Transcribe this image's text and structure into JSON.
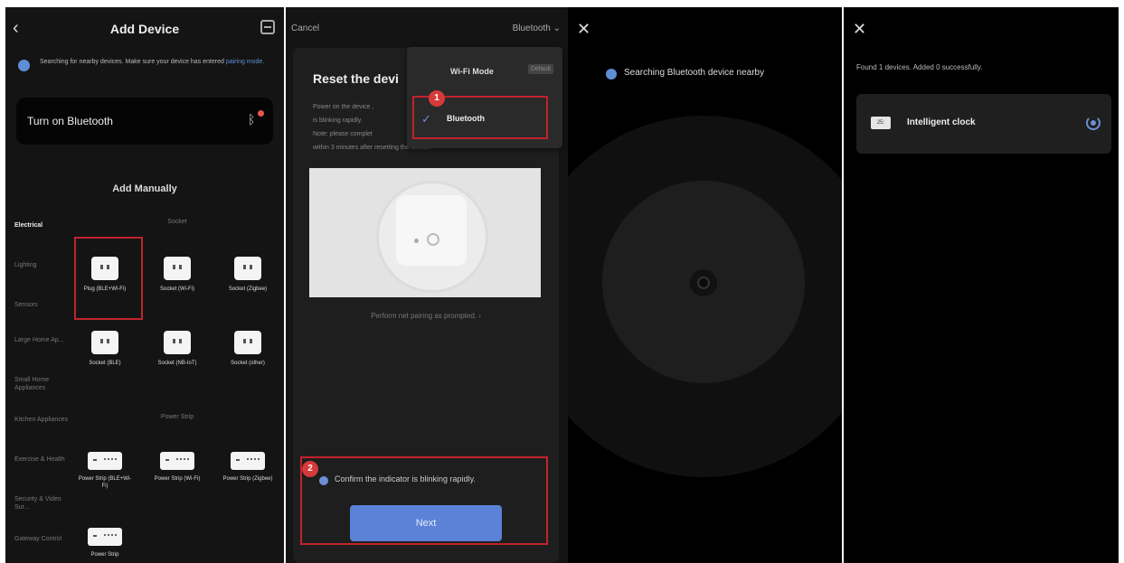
{
  "panel1": {
    "back_icon": "‹",
    "title": "Add Device",
    "notice_text": "Searching for nearby devices. Make sure your device has entered ",
    "notice_link": "pairing mode.",
    "bt_card_label": "Turn on Bluetooth",
    "section_title": "Add Manually",
    "categories": [
      "Electrical",
      "Lighting",
      "Sensors",
      "Large Home Ap...",
      "Small Home Appliances",
      "Kitchen Appliances",
      "Exercise & Health",
      "Security & Video Sur...",
      "Gateway Control"
    ],
    "group_socket": "Socket",
    "group_power_strip": "Power Strip",
    "devices": {
      "plug": "Plug (BLE+Wi-Fi)",
      "socket_wifi": "Socket (Wi-Fi)",
      "socket_zigbee": "Socket (Zigbee)",
      "socket_ble": "Socket (BLE)",
      "socket_nbiot": "Socket (NB-IoT)",
      "socket_other": "Socket (other)",
      "strip_ble_wifi": "Power Strip (BLE+Wi-Fi)",
      "strip_wifi": "Power Strip (Wi-Fi)",
      "strip_zigbee": "Power Strip (Zigbee)",
      "strip_last": "Power Strip"
    }
  },
  "panel2": {
    "cancel": "Cancel",
    "mode_selector": "Bluetooth ⌄",
    "heading": "Reset the devi",
    "desc_line1": "Power on the device ,",
    "desc_line2": "is blinking rapidly.",
    "desc_line3": "Note: please complet",
    "desc_line4": "within 3 minutes after resetting the device.",
    "hint": "Perform net pairing as prompted. ›",
    "confirm": "Confirm the indicator is blinking rapidly.",
    "next": "Next",
    "dropdown_title": "Wi-Fi Mode",
    "dropdown_default": "Default",
    "dropdown_selected": "Bluetooth",
    "badge1": "1",
    "badge2": "2"
  },
  "panel3": {
    "close_icon": "✕",
    "status": "Searching Bluetooth device nearby"
  },
  "panel4": {
    "close_icon": "✕",
    "found": "Found 1 devices. Added 0 successfully.",
    "device_name": "Intelligent clock",
    "device_thumb": "25:"
  },
  "colors": {
    "accent": "#5e8fd6",
    "highlight_red": "#c0232c",
    "badge_red": "#d63a3a"
  }
}
